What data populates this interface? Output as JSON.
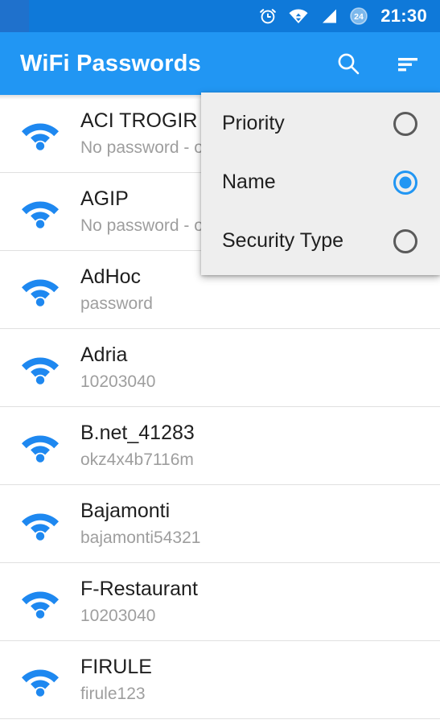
{
  "status_bar": {
    "time": "21:30",
    "icons": [
      "alarm-icon",
      "wifi-icon",
      "cellular-signal-icon",
      "24-hour-badge-icon"
    ],
    "background_color": "#0f79d9"
  },
  "app_bar": {
    "title": "WiFi Passwords",
    "background_color": "#2196f3",
    "actions": [
      {
        "name": "search-icon",
        "label": "Search"
      },
      {
        "name": "sort-icon",
        "label": "Sort"
      }
    ]
  },
  "sort_menu": {
    "visible": true,
    "background_color": "#eeeeee",
    "accent_color": "#2196f3",
    "items": [
      {
        "label": "Priority",
        "selected": false
      },
      {
        "label": "Name",
        "selected": true
      },
      {
        "label": "Security Type",
        "selected": false
      }
    ]
  },
  "network_list": {
    "icon_color": "#1e88f0",
    "rows": [
      {
        "ssid": "ACI TROGIR",
        "password": "No password - o"
      },
      {
        "ssid": "AGIP",
        "password": "No password - o"
      },
      {
        "ssid": "AdHoc",
        "password": "password"
      },
      {
        "ssid": "Adria",
        "password": "10203040"
      },
      {
        "ssid": "B.net_41283",
        "password": "okz4x4b7116m"
      },
      {
        "ssid": "Bajamonti",
        "password": "bajamonti54321"
      },
      {
        "ssid": "F-Restaurant",
        "password": "10203040"
      },
      {
        "ssid": "FIRULE",
        "password": "firule123"
      }
    ]
  }
}
